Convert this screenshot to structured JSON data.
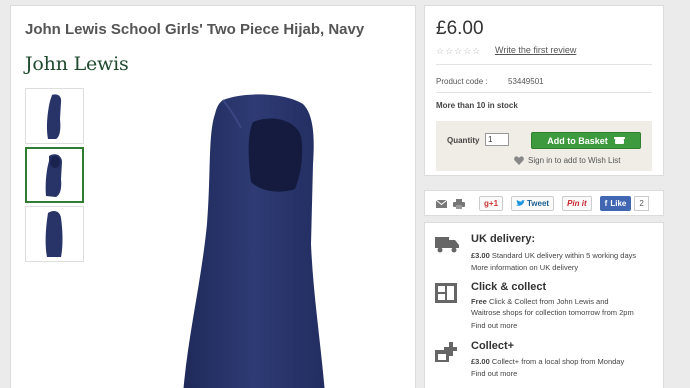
{
  "product": {
    "title": "John Lewis School Girls' Two Piece Hijab, Navy",
    "brand": "John Lewis",
    "thumbnails": [
      "front view",
      "side view",
      "back view"
    ],
    "selected_thumbnail": 1
  },
  "buy": {
    "price": "£6.00",
    "stars": "☆☆☆☆☆",
    "rating_link": "Write the first review",
    "product_code_label": "Product code :",
    "product_code": "53449501",
    "stock": "More than 10 in stock",
    "quantity_label": "Quantity",
    "quantity_value": "1",
    "add_to_basket": "Add to Basket",
    "wishlist": "Sign in to add to Wish List"
  },
  "share": {
    "gplus": "+1",
    "tweet": "Tweet",
    "pinit": "Pin it",
    "fb_like": "Like",
    "fb_count": "2"
  },
  "delivery": {
    "uk": {
      "title": "UK delivery:",
      "price": "£3.00",
      "text": "Standard UK delivery within 5 working days",
      "link": "More information on UK delivery"
    },
    "click_collect": {
      "title": "Click & collect",
      "free": "Free",
      "text1": "Click & Collect from John Lewis and",
      "text2": "Waitrose shops for collection tomorrow from 2pm",
      "link": "Find out more"
    },
    "collect_plus": {
      "title": "Collect+",
      "price": "£3.00",
      "text": "Collect+ from a local shop from Monday",
      "link": "Find out more"
    }
  },
  "colors": {
    "brand_green": "#1f4a2e",
    "basket_green": "#3e9a3e",
    "hijab_navy": "#283468"
  }
}
